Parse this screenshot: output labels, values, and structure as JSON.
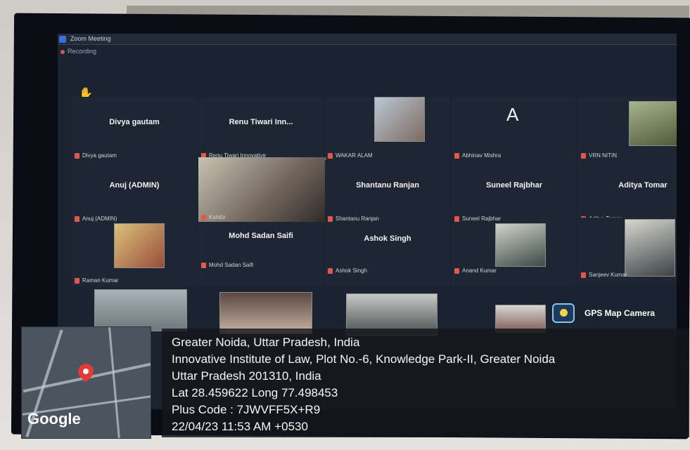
{
  "meeting": {
    "window_title": "Zoom Meeting",
    "recording_label": "Recording"
  },
  "tiles": [
    {
      "center": "Divya gautam",
      "name": "Divya gautam"
    },
    {
      "center": "Renu Tiwari Inn...",
      "name": "Renu Tiwari Innovative"
    },
    {
      "center": "",
      "name": "WAKAR ALAM"
    },
    {
      "center": "",
      "name": "Abhinav Mishra",
      "letter": "A"
    },
    {
      "center": "",
      "name": "VRN NITIN"
    },
    {
      "center": "Anuj (ADMIN)",
      "name": "Anuj (ADMIN)"
    },
    {
      "center": "",
      "name": "Kshitiz"
    },
    {
      "center": "Shantanu Ranjan",
      "name": "Shantanu Ranjan"
    },
    {
      "center": "Suneel Rajbhar",
      "name": "Suneel Rajbhar"
    },
    {
      "center": "Aditya Tomar",
      "name": "Aditya Tomar"
    },
    {
      "center": "",
      "name": "Raman Kumar"
    },
    {
      "center": "Mohd Sadan Saifi",
      "name": "Mohd Sadan Saifi"
    },
    {
      "center": "Ashok Singh",
      "name": "Ashok Singh"
    },
    {
      "center": "",
      "name": "Anand Kumar"
    },
    {
      "center": "",
      "name": "Sanjeev Kumar"
    }
  ],
  "gps": {
    "app_label": "GPS Map Camera",
    "map_brand": "Google",
    "line1": "Greater Noida, Uttar Pradesh, India",
    "line2": "Innovative Institute of Law, Plot No.-6, Knowledge Park-II, Greater Noida",
    "line3": "Uttar Pradesh 201310, India",
    "line4": "Lat 28.459622 Long 77.498453",
    "line5": "Plus Code : 7JWVFF5X+R9",
    "line6": "22/04/23 11:53 AM +0530"
  },
  "colors": {
    "screen_bg": "#1c2330",
    "mic_muted": "#e2574c",
    "pin": "#e53935"
  }
}
